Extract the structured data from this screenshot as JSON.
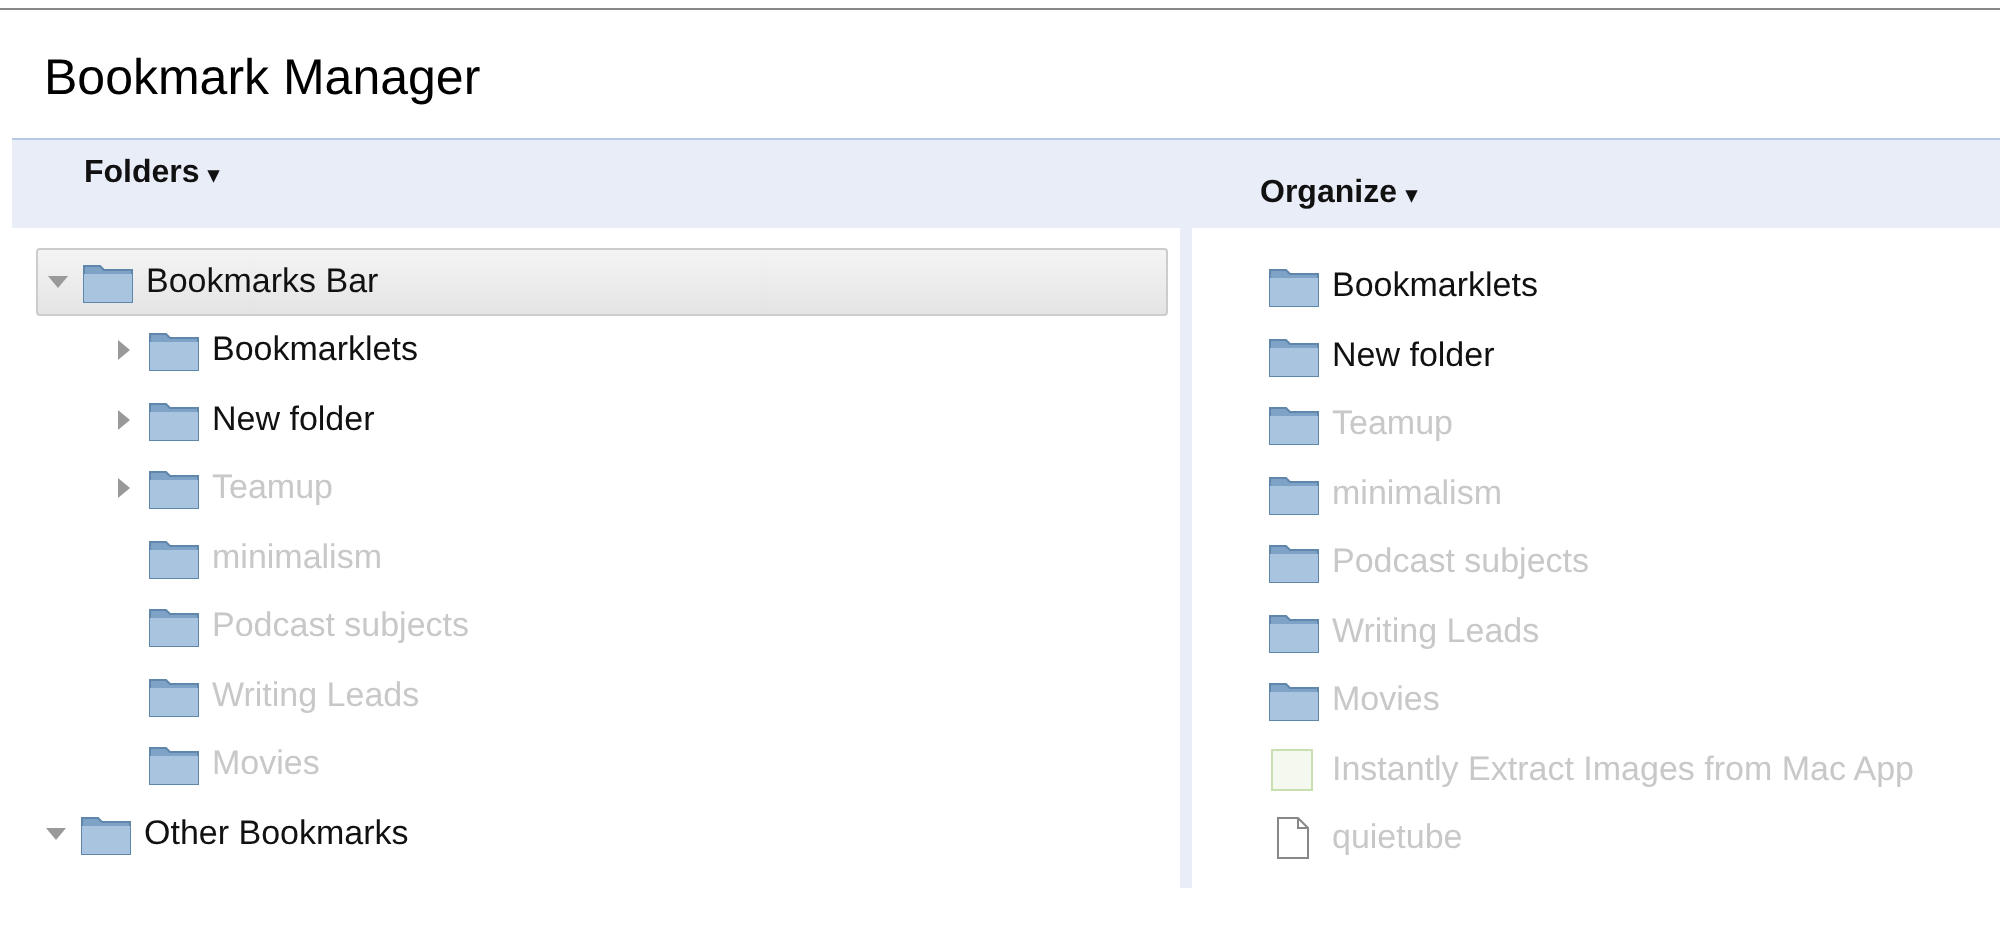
{
  "window": {
    "title": "Bookmark Manager"
  },
  "folders_menu": {
    "label": "Folders",
    "caret": "▾"
  },
  "organize_menu": {
    "label": "Organize",
    "caret": "▾"
  },
  "tree": [
    {
      "label": "Bookmarks Bar",
      "expanded": true,
      "selected": true,
      "faded": false,
      "children": [
        {
          "label": "Bookmarklets",
          "faded": false,
          "has_children": true
        },
        {
          "label": "New folder",
          "faded": false,
          "has_children": true
        },
        {
          "label": "Teamup",
          "faded": true,
          "has_children": true
        },
        {
          "label": "minimalism",
          "faded": true,
          "has_children": false
        },
        {
          "label": "Podcast subjects",
          "faded": true,
          "has_children": false
        },
        {
          "label": "Writing Leads",
          "faded": true,
          "has_children": false
        },
        {
          "label": "Movies",
          "faded": true,
          "has_children": false
        }
      ]
    },
    {
      "label": "Other Bookmarks",
      "expanded": true,
      "selected": false,
      "faded": false
    }
  ],
  "list": [
    {
      "kind": "folder",
      "label": "Bookmarklets",
      "faded": false
    },
    {
      "kind": "folder",
      "label": "New folder",
      "faded": false
    },
    {
      "kind": "folder",
      "label": "Teamup",
      "faded": true
    },
    {
      "kind": "folder",
      "label": "minimalism",
      "faded": true
    },
    {
      "kind": "folder",
      "label": "Podcast subjects",
      "faded": true
    },
    {
      "kind": "folder",
      "label": "Writing Leads",
      "faded": true
    },
    {
      "kind": "folder",
      "label": "Movies",
      "faded": true
    },
    {
      "kind": "page",
      "label": "Instantly Extract Images from Mac App",
      "faded": true
    },
    {
      "kind": "file",
      "label": "quietube",
      "faded": true
    }
  ]
}
